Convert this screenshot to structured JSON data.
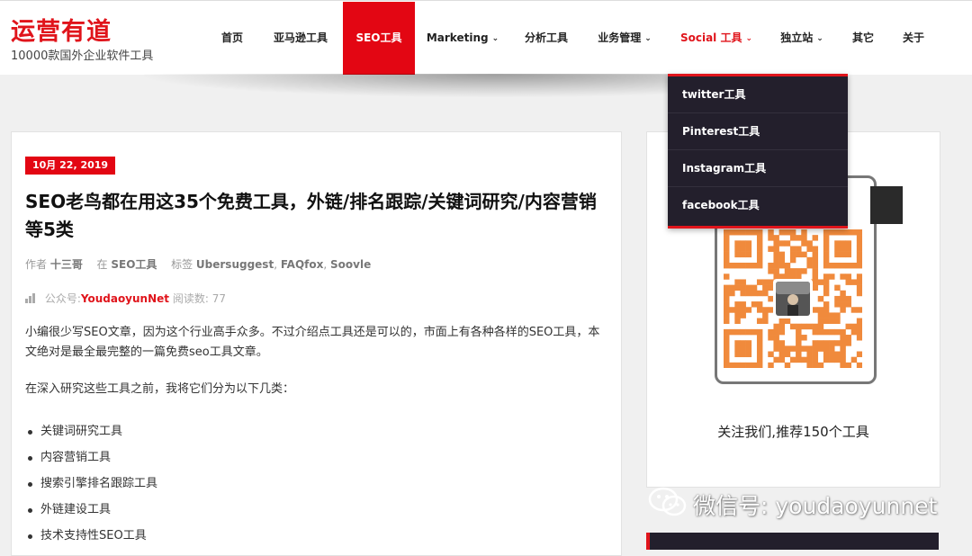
{
  "site": {
    "title": "运营有道",
    "subtitle": "10000款国外企业软件工具"
  },
  "nav": {
    "items": [
      {
        "label": "首页"
      },
      {
        "label": "亚马逊工具"
      },
      {
        "label": "SEO工具",
        "active": true
      },
      {
        "label": "Marketing"
      },
      {
        "label": "分析工具"
      },
      {
        "label": "业务管理"
      },
      {
        "label": "Social 工具"
      },
      {
        "label": "独立站"
      },
      {
        "label": "其它"
      },
      {
        "label": "关于"
      }
    ],
    "chevron": "⌄",
    "social_dropdown": [
      "twitter工具",
      "Pinterest工具",
      "Instagram工具",
      "facebook工具"
    ]
  },
  "post": {
    "date": "10月 22, 2019",
    "title": "SEO老鸟都在用这35个免费工具，外链/排名跟踪/关键词研究/内容营销等5类",
    "meta": {
      "author_label": "作者",
      "author": "十三哥",
      "in_label": "在",
      "category": "SEO工具",
      "tags_label": "标签",
      "tag1": "Ubersuggest",
      "tag2": "FAQfox",
      "tag3": "Soovle",
      "sep": ","
    },
    "stats": {
      "account_label": "公众号:",
      "account": "YoudaoyunNet",
      "reads_label": "阅读数:",
      "reads": "77"
    },
    "intro": "小编很少写SEO文章，因为这个行业高手众多。不过介绍点工具还是可以的，市面上有各种各样的SEO工具，本文绝对是最全最完整的一篇免费seo工具文章。",
    "lead": "在深入研究这些工具之前，我将它们分为以下几类：",
    "categories": [
      "关键词研究工具",
      "内容营销工具",
      "搜索引擎排名跟踪工具",
      "外链建设工具",
      "技术支持性SEO工具"
    ]
  },
  "sidebar": {
    "follow_text": "关注我们,推荐150个工具"
  },
  "watermark": "微信号: youdaoyunnet",
  "colors": {
    "brand_red": "#e0141b",
    "nav_active": "#e30613",
    "dropdown_bg": "#231f2c",
    "qr_orange": "#f08a3c"
  }
}
